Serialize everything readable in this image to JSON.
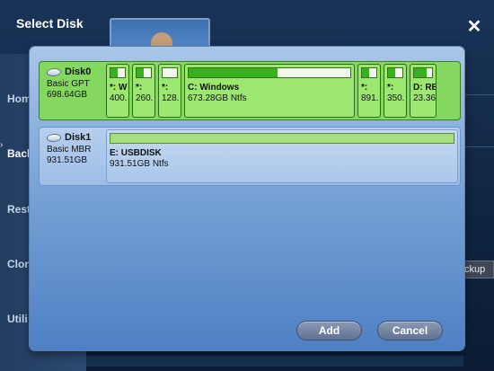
{
  "dialog": {
    "title": "Select Disk",
    "close_icon": "close-icon"
  },
  "background": {
    "nav": [
      "Hom",
      "Back",
      "Rest",
      "Clon",
      "Utili"
    ],
    "active_nav": "Back",
    "backup_tab": "ckup"
  },
  "disks": [
    {
      "name": "Disk0",
      "type": "Basic GPT",
      "size": "698.64GB",
      "selected": true,
      "partitions": [
        {
          "label": "*: W",
          "size": "400.",
          "fill": 0.5
        },
        {
          "label": "*:",
          "size": "260.",
          "fill": 0.5
        },
        {
          "label": "*:",
          "size": "128.",
          "fill": 0.0
        },
        {
          "label": "C: Windows",
          "size": "673.28GB Ntfs",
          "fill": 0.55
        },
        {
          "label": "*:",
          "size": "891.",
          "fill": 0.5
        },
        {
          "label": "*:",
          "size": "350.",
          "fill": 0.5
        },
        {
          "label": "D: RE",
          "size": "23.36",
          "fill": 0.7
        }
      ]
    },
    {
      "name": "Disk1",
      "type": "Basic MBR",
      "size": "931.51GB",
      "selected": false,
      "partitions": [
        {
          "label": "E: USBDISK",
          "size": "931.51GB Ntfs",
          "fill": 1.0
        }
      ]
    }
  ],
  "buttons": {
    "add": "Add",
    "cancel": "Cancel"
  },
  "colors": {
    "selected_disk": "#84d860",
    "used_space": "#39b01d",
    "dialog_panel": "#7aa4d6"
  }
}
